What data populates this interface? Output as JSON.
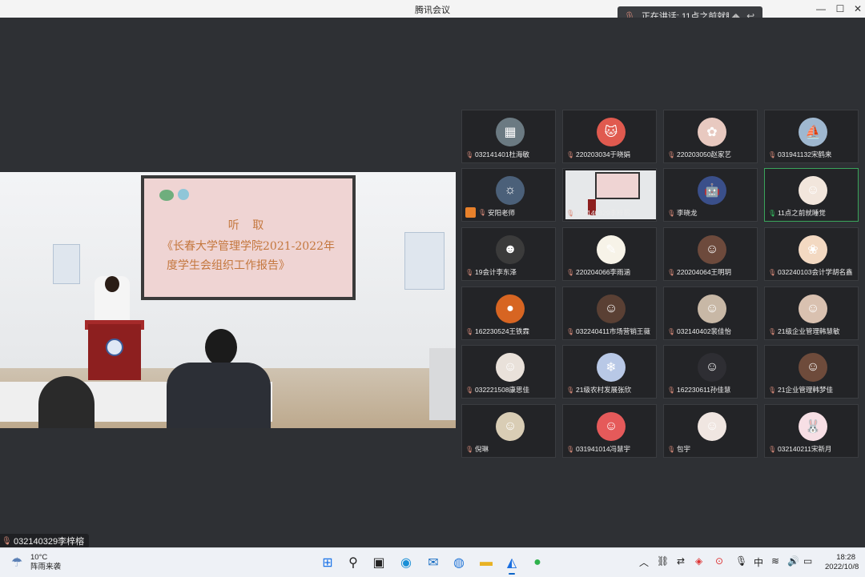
{
  "window": {
    "title": "腾讯会议",
    "min_icon": "minimize-icon",
    "max_icon": "maximize-icon",
    "close_icon": "close-icon"
  },
  "speaking": {
    "label": "正在讲话: 11点之前就睡觉"
  },
  "main_video": {
    "participant": "032140329李梓榕",
    "screen_line1": "听 取",
    "screen_line2": "《长春大学管理学院2021-2022年",
    "screen_line3": "度学生会组织工作报告》"
  },
  "participants": [
    {
      "name": "032141401杜海敏",
      "avatar_color": "#6b7a82",
      "glyph": "▦"
    },
    {
      "name": "220203034于晓娟",
      "avatar_color": "#e05a4f",
      "glyph": "🐱"
    },
    {
      "name": "220203050赵家艺",
      "avatar_color": "#e8c9c0",
      "glyph": "✿"
    },
    {
      "name": "031941132宋鹤来",
      "avatar_color": "#9fb8d0",
      "glyph": "⛵"
    },
    {
      "name": "安阳老师",
      "avatar_color": "#4b6079",
      "glyph": "☼",
      "host": true
    },
    {
      "name": "032140329李梓榕",
      "video": true
    },
    {
      "name": "李晓龙",
      "avatar_color": "#3a4f8a",
      "glyph": "🤖"
    },
    {
      "name": "11点之前就睡觉",
      "avatar_color": "#f2e6dc",
      "glyph": "☺",
      "speaking": true
    },
    {
      "name": "19会计李东泽",
      "avatar_color": "#3b3b3b",
      "glyph": "☻"
    },
    {
      "name": "220204066李雨涵",
      "avatar_color": "#f7f3e8",
      "glyph": "✎"
    },
    {
      "name": "220204064王明玥",
      "avatar_color": "#6d4a3c",
      "glyph": "☺"
    },
    {
      "name": "032240103会计学胡名鑫",
      "avatar_color": "#f3d9c2",
      "glyph": "❀"
    },
    {
      "name": "162230524王铁霖",
      "avatar_color": "#d76522",
      "glyph": "●"
    },
    {
      "name": "032240411市场营销王薇",
      "avatar_color": "#5a4034",
      "glyph": "☺"
    },
    {
      "name": "032140402裴佳怡",
      "avatar_color": "#c8b8a6",
      "glyph": "☺"
    },
    {
      "name": "21级企业管理韩慧敏",
      "avatar_color": "#d9c1b0",
      "glyph": "☺"
    },
    {
      "name": "032221508康思佳",
      "avatar_color": "#e9e1da",
      "glyph": "☺"
    },
    {
      "name": "21级农村发展张欣",
      "avatar_color": "#b8c8e6",
      "glyph": "❄"
    },
    {
      "name": "162230611孙佳慧",
      "avatar_color": "#2e2e33",
      "glyph": "☺"
    },
    {
      "name": "21企业管理韩梦佳",
      "avatar_color": "#6e4b3b",
      "glyph": "☺"
    },
    {
      "name": "倪琳",
      "avatar_color": "#d9cdb5",
      "glyph": "☺"
    },
    {
      "name": "031941014冯慧宇",
      "avatar_color": "#e55a5a",
      "glyph": "☺"
    },
    {
      "name": "包宇",
      "avatar_color": "#f0e6e1",
      "glyph": "☺"
    },
    {
      "name": "032140211宋新月",
      "avatar_color": "#f7dfe5",
      "glyph": "🐰"
    }
  ],
  "taskbar": {
    "weather_temp": "10°C",
    "weather_desc": "阵雨来袭",
    "time": "18:28",
    "date": "2022/10/8",
    "ime": "中"
  }
}
